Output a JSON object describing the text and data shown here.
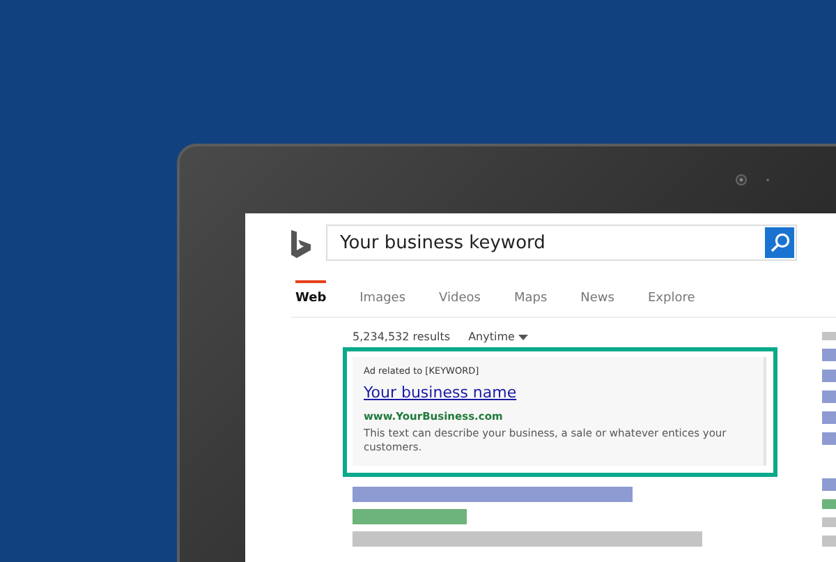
{
  "search": {
    "value": "Your business keyword"
  },
  "tabs": [
    {
      "label": "Web",
      "selected": true
    },
    {
      "label": "Images",
      "selected": false
    },
    {
      "label": "Videos",
      "selected": false
    },
    {
      "label": "Maps",
      "selected": false
    },
    {
      "label": "News",
      "selected": false
    },
    {
      "label": "Explore",
      "selected": false
    }
  ],
  "results": {
    "count": "5,234,532 results",
    "filter": "Anytime"
  },
  "ad": {
    "label": "Ad related to [KEYWORD]",
    "title": "Your business name",
    "url": "www.YourBusiness.com",
    "description": "This text can describe your business, a sale or whatever entices your customers."
  }
}
